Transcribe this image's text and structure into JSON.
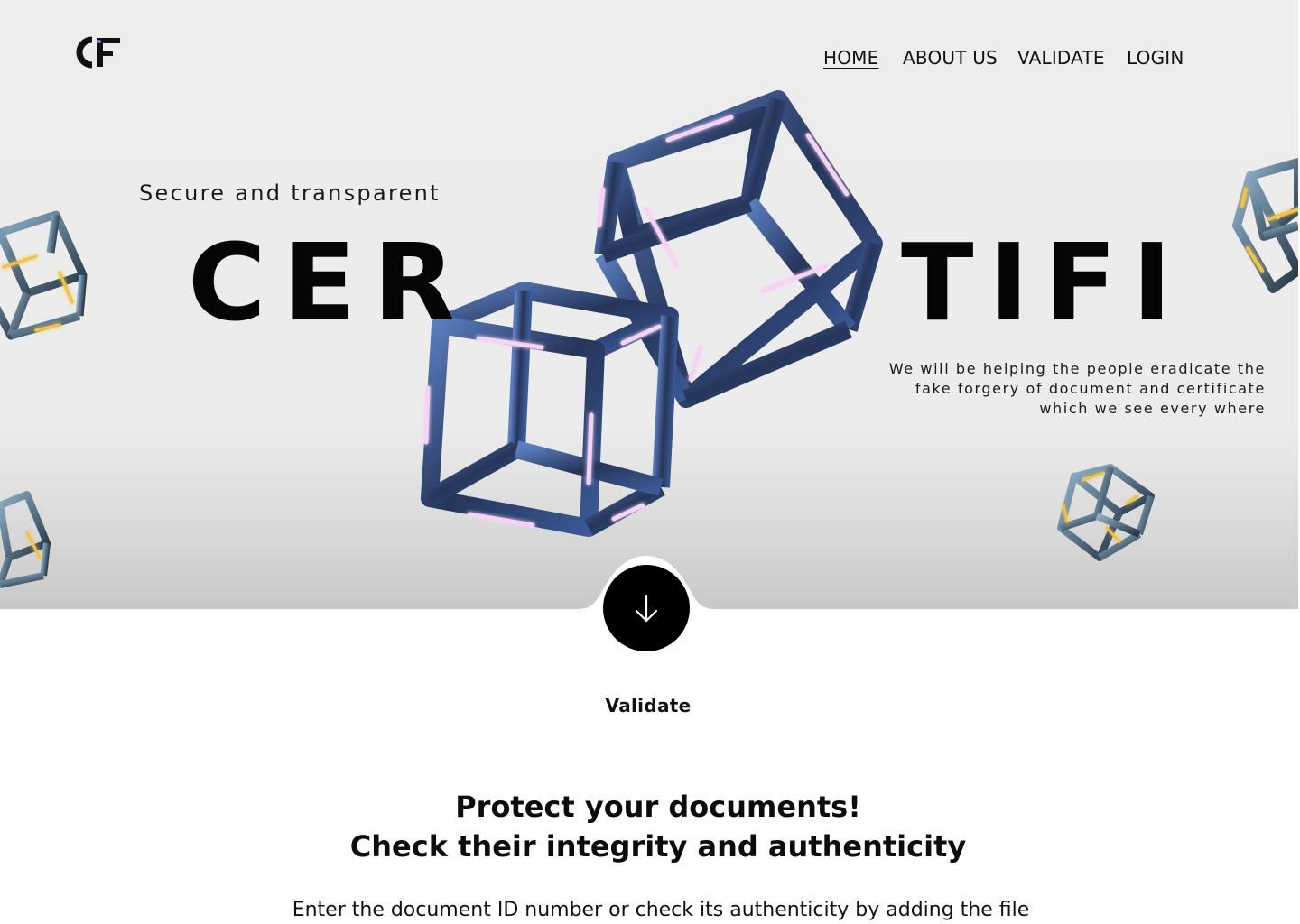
{
  "logo": {
    "text": "CF",
    "icon": "cf-logo"
  },
  "nav": {
    "items": [
      {
        "label": "HOME",
        "active": true
      },
      {
        "label": "ABOUT US",
        "active": false
      },
      {
        "label": "VALIDATE",
        "active": false
      },
      {
        "label": "LOGIN",
        "active": false
      }
    ]
  },
  "hero": {
    "tagline": "Secure and transparent",
    "brand_left": "CER",
    "brand_right": "TIFI",
    "description": "We will be helping the people eradicate the fake forgery of document and certificate which we see every where"
  },
  "scroll_button": {
    "icon": "arrow-down-icon"
  },
  "validate_section": {
    "label": "Validate",
    "headline_line1": "Protect your documents!",
    "headline_line2": "Check their integrity and authenticity",
    "instruction": "Enter the document ID number or check its authenticity by adding the file"
  },
  "colors": {
    "hero_bg": "#ededed",
    "text": "#111111",
    "accent_cube": "#2a3f6b",
    "glow_pink": "#f3c6f0",
    "glow_gold": "#f2c14a"
  }
}
